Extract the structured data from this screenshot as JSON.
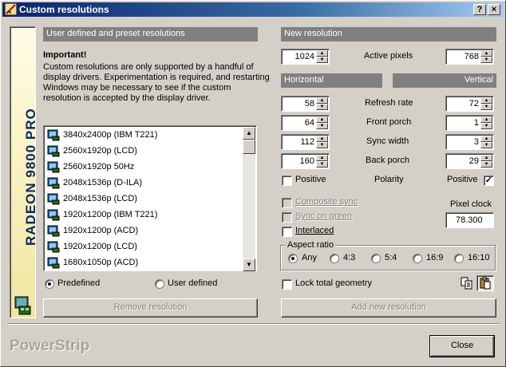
{
  "title": "Custom resolutions",
  "title_buttons": {
    "help": "?",
    "close": "×"
  },
  "side": {
    "brand": "RADEON 9800 PRO"
  },
  "left": {
    "header": "User defined and preset resolutions",
    "important_label": "Important!",
    "important_text": [
      "Custom resolutions are only supported by a handful of",
      "display drivers. Experimentation is required, and restarting",
      "Windows may be necessary to see if the custom",
      "resolution is accepted by the display driver."
    ],
    "resolutions": [
      "3840x2400p (IBM T221)",
      "2560x1920p (LCD)",
      "2560x1920p 50Hz",
      "2048x1536p (D-ILA)",
      "2048x1536p (LCD)",
      "1920x1200p (IBM T221)",
      "1920x1200p (ACD)",
      "1920x1200p (LCD)",
      "1680x1050p (ACD)"
    ],
    "predefined_label": "Predefined",
    "user_defined_label": "User defined",
    "remove_button": "Remove resolution"
  },
  "right": {
    "header": "New resolution",
    "active_pixels_label": "Active pixels",
    "active_h": "1024",
    "active_v": "768",
    "horizontal_label": "Horizontal",
    "vertical_label": "Vertical",
    "rows": [
      {
        "label": "Refresh rate",
        "h": "58",
        "v": "72"
      },
      {
        "label": "Front porch",
        "h": "64",
        "v": "1"
      },
      {
        "label": "Sync width",
        "h": "112",
        "v": "3"
      },
      {
        "label": "Back porch",
        "h": "160",
        "v": "29"
      }
    ],
    "positive_label": "Positive",
    "polarity_label": "Polarity",
    "positive_v_label": "Positive",
    "composite_sync": "Composite sync",
    "sync_on_green": "Sync on green",
    "interlaced": "Interlaced",
    "pixel_clock_label": "Pixel clock",
    "pixel_clock": "78.300",
    "aspect_label": "Aspect ratio",
    "aspect_options": [
      "Any",
      "4:3",
      "5:4",
      "16:9",
      "16:10"
    ],
    "lock_label": "Lock total geometry",
    "add_button": "Add new resolution"
  },
  "footer": {
    "brand": "PowerStrip",
    "close_button": "Close"
  },
  "colors": {
    "titlebar": "#0a246a",
    "header_bar": "#808080",
    "brand_text": "#0a2a6a",
    "face": "#d4d0c8"
  }
}
